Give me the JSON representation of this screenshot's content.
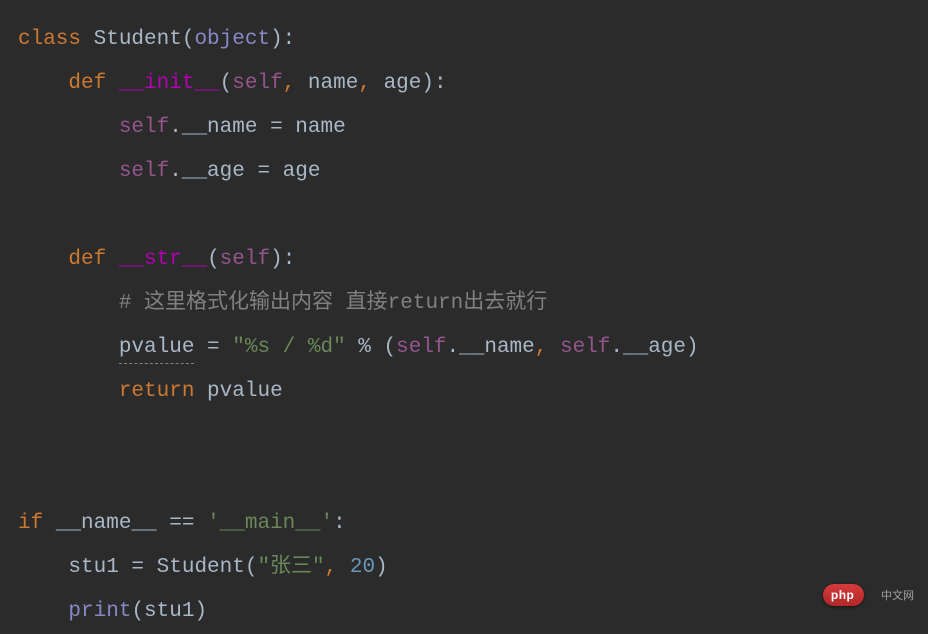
{
  "code": {
    "line1": {
      "kw_class": "class",
      "class_name": " Student",
      "paren_open": "(",
      "object": "object",
      "paren_close_colon": "):"
    },
    "line2": {
      "indent": "    ",
      "kw_def": "def",
      "space": " ",
      "method": "__init__",
      "paren_open": "(",
      "self": "self",
      "comma1": ", ",
      "param_name": "name",
      "comma2": ", ",
      "param_age": "age",
      "paren_close_colon": "):"
    },
    "line3": {
      "indent": "        ",
      "self": "self",
      "text": ".__name = name"
    },
    "line4": {
      "indent": "        ",
      "self": "self",
      "text": ".__age = age"
    },
    "line6": {
      "indent": "    ",
      "kw_def": "def",
      "space": " ",
      "method": "__str__",
      "paren_open": "(",
      "self": "self",
      "paren_close_colon": "):"
    },
    "line7": {
      "indent": "        ",
      "comment": "# 这里格式化输出内容 直接return出去就行"
    },
    "line8": {
      "indent": "        ",
      "pvalue": "pvalue",
      "eq": " = ",
      "str": "\"%s / %d\"",
      "mod": " % (",
      "self1": "self",
      "attr1": ".__name",
      "comma": ", ",
      "self2": "self",
      "attr2": ".__age)"
    },
    "line9": {
      "indent": "        ",
      "kw_return": "return",
      "text": " pvalue"
    },
    "line12": {
      "kw_if": "if",
      "space": " ",
      "name": "__name__ == ",
      "str": "'__main__'",
      "colon": ":"
    },
    "line13": {
      "indent": "    ",
      "text1": "stu1 = Student(",
      "str": "\"张三\"",
      "comma": ", ",
      "num": "20",
      "paren": ")"
    },
    "line14": {
      "indent": "    ",
      "print": "print",
      "text": "(stu1)"
    }
  },
  "watermark": {
    "label": "php",
    "tail": "中文网"
  }
}
